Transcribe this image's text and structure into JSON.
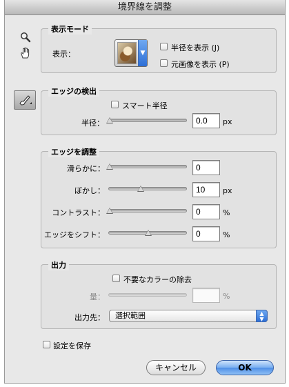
{
  "window": {
    "title": "境界線を調整"
  },
  "tools": [
    {
      "name": "zoom-tool",
      "icon": "magnifier-icon"
    },
    {
      "name": "hand-tool",
      "icon": "hand-icon"
    },
    {
      "name": "refine-radius-tool",
      "icon": "brush-icon"
    }
  ],
  "view_mode": {
    "legend": "表示モード",
    "view_label": "表示：",
    "show_radius_label": "半径を表示 (J)",
    "show_original_label": "元画像を表示 (P)",
    "show_radius_checked": false,
    "show_original_checked": false
  },
  "edge_detection": {
    "legend": "エッジの検出",
    "smart_radius_label": "スマート半径",
    "smart_radius_checked": false,
    "radius_label": "半径：",
    "radius_value": "0.0",
    "radius_unit": "px",
    "radius_slider_fraction": 0
  },
  "adjust_edge": {
    "legend": "エッジを調整",
    "smooth_label": "滑らかに：",
    "smooth_value": "0",
    "feather_label": "ぼかし：",
    "feather_value": "10",
    "feather_unit": "px",
    "contrast_label": "コントラスト：",
    "contrast_value": "0",
    "contrast_unit": "%",
    "shift_edge_label": "エッジをシフト：",
    "shift_edge_value": "0",
    "shift_edge_unit": "%"
  },
  "output": {
    "legend": "出力",
    "decontaminate_label": "不要なカラーの除去",
    "decontaminate_checked": false,
    "amount_label": "量：",
    "amount_value": "",
    "amount_unit": "%",
    "output_to_label": "出力先：",
    "output_to_value": "選択範囲"
  },
  "remember_settings": {
    "label": "設定を保存",
    "checked": false
  },
  "buttons": {
    "cancel": "キャンセル",
    "ok": "OK"
  }
}
